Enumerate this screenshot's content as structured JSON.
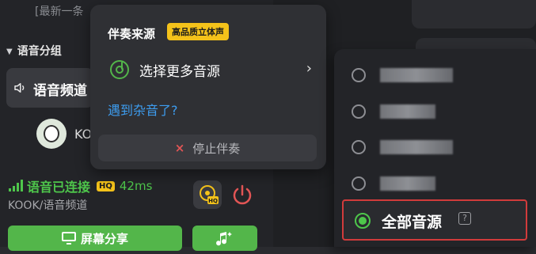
{
  "sidebar": {
    "latest_text": "[最新一条",
    "group_title": "语音分组",
    "channel_name": "语音频道",
    "user_name": "KO",
    "status_text": "语音已连接",
    "status_badge": "HQ",
    "latency": "42ms",
    "channel_path": "KOOK/语音频道",
    "screen_share_label": "屏幕分享"
  },
  "accompaniment_popup": {
    "title": "伴奏来源",
    "badge": "高品质立体声",
    "more_sources_label": "选择更多音源",
    "chevron": "›",
    "noise_link": "遇到杂音了?",
    "stop_x": "×",
    "stop_label": "停止伴奏"
  },
  "source_list": {
    "selected_label": "全部音源",
    "help_icon_text": "?",
    "selected_color": "#4ec64b",
    "highlight_color": "#d23b3b"
  },
  "colors": {
    "accent_green": "#53b64a",
    "link_blue": "#3d9df0",
    "badge_yellow": "#f4c21a",
    "danger_red": "#e25555"
  }
}
